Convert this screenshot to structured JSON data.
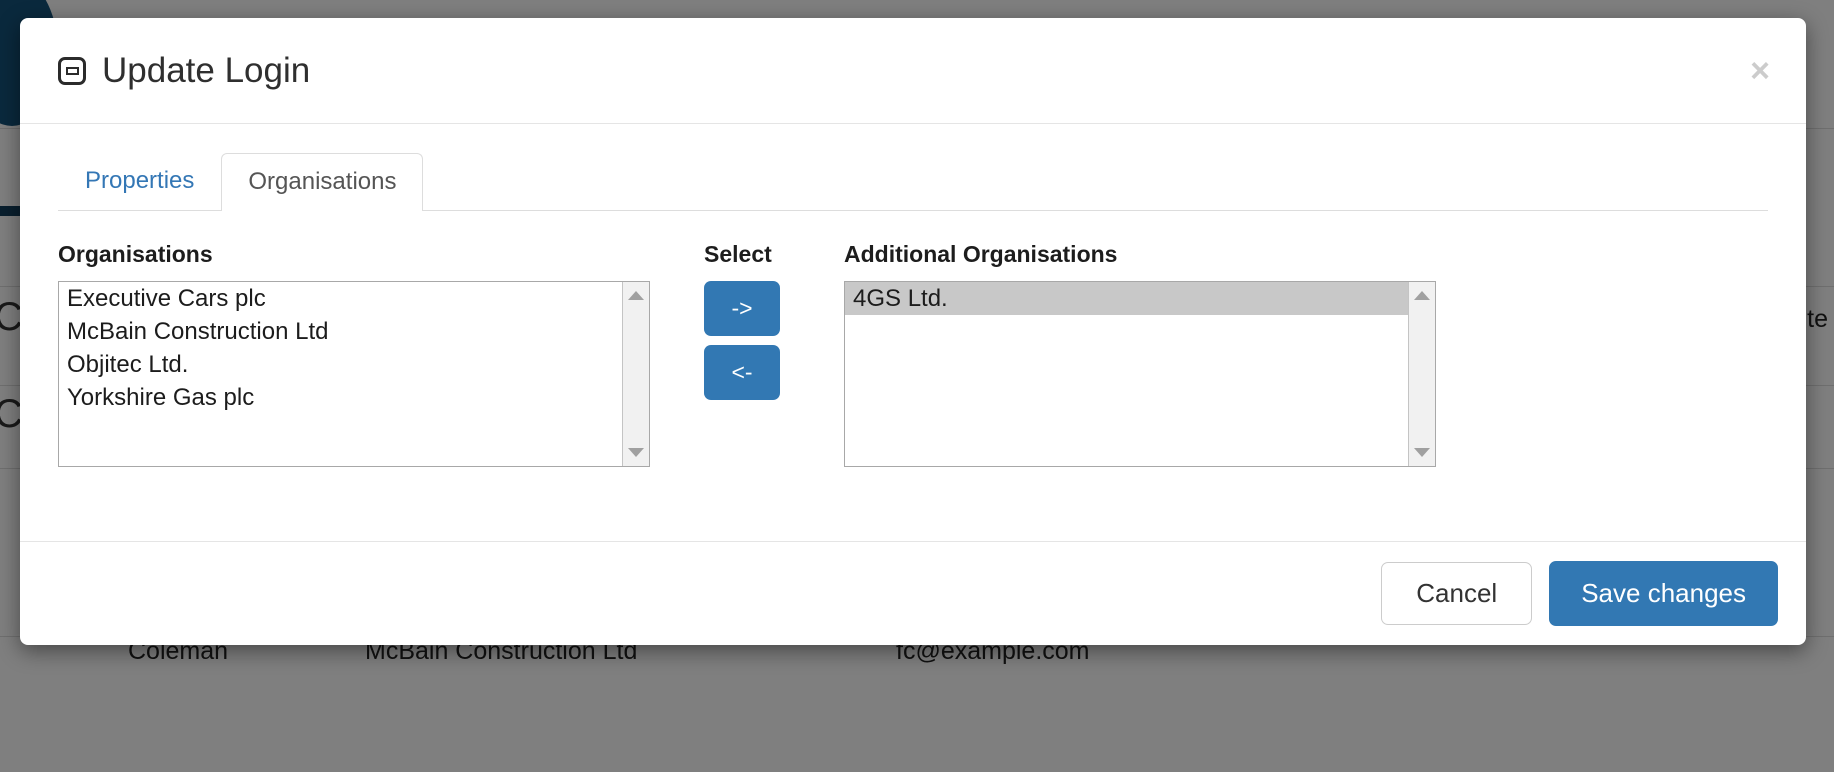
{
  "background": {
    "table_row": {
      "name": "Coleman",
      "organisation": "McBain Construction Ltd",
      "email": "fc@example.com"
    },
    "right_fragment": "te",
    "left_glyph_1": "C",
    "left_glyph_2": "C"
  },
  "modal": {
    "title": "Update Login",
    "title_icon": "window-icon",
    "close_label": "×",
    "tabs": [
      {
        "label": "Properties",
        "active": false
      },
      {
        "label": "Organisations",
        "active": true
      }
    ],
    "left_list": {
      "label": "Organisations",
      "options": [
        {
          "text": "Executive Cars plc",
          "selected": false
        },
        {
          "text": "McBain Construction Ltd",
          "selected": false
        },
        {
          "text": "Objitec Ltd.",
          "selected": false
        },
        {
          "text": "Yorkshire Gas plc",
          "selected": false
        }
      ]
    },
    "middle": {
      "label": "Select",
      "add_label": "->",
      "remove_label": "<-"
    },
    "right_list": {
      "label": "Additional Organisations",
      "options": [
        {
          "text": "4GS Ltd.",
          "selected": true
        }
      ]
    },
    "footer": {
      "cancel_label": "Cancel",
      "save_label": "Save changes"
    }
  },
  "colors": {
    "primary": "#3278b3",
    "link": "#3477b5",
    "selected_row": "#c8c8c8",
    "brand_dark_blue": "#15537a"
  }
}
